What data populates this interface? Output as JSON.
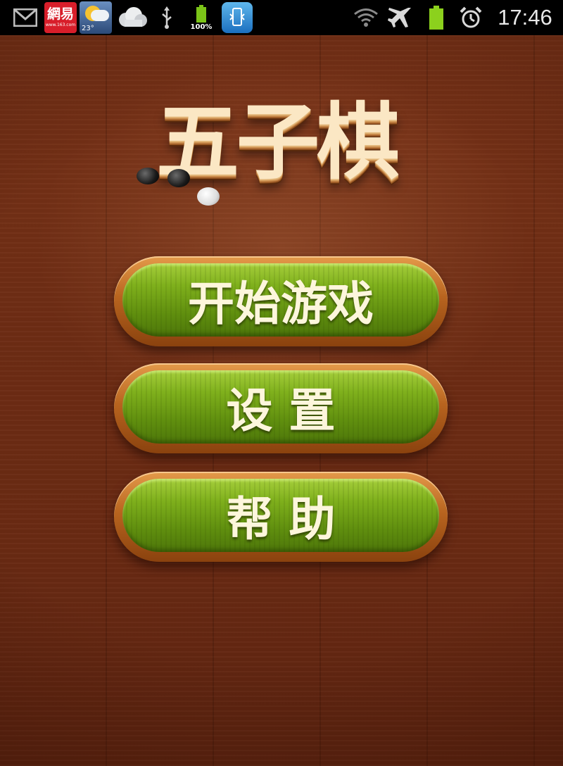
{
  "status_bar": {
    "time": "17:46",
    "notification_icons": [
      "gmail-icon",
      "netease-icon",
      "weather-icon",
      "cloud-icon",
      "usb-icon",
      "battery-100-icon",
      "phone-sync-icon"
    ],
    "netease_label": "網易",
    "netease_sub": "www.163.com",
    "weather_temp": "23°",
    "battery_app_label": "100%",
    "system_icons": [
      "wifi-icon",
      "airplane-mode-icon",
      "battery-icon",
      "alarm-icon"
    ]
  },
  "game": {
    "title": "五子棋"
  },
  "menu": {
    "start_label": "开始游戏",
    "settings_label": "设 置",
    "help_label": "帮 助"
  },
  "colors": {
    "wood_background": "#6e2c14",
    "button_green": "#7fb01c",
    "button_rim": "#b8641f",
    "label_text": "#fdf6dc"
  }
}
